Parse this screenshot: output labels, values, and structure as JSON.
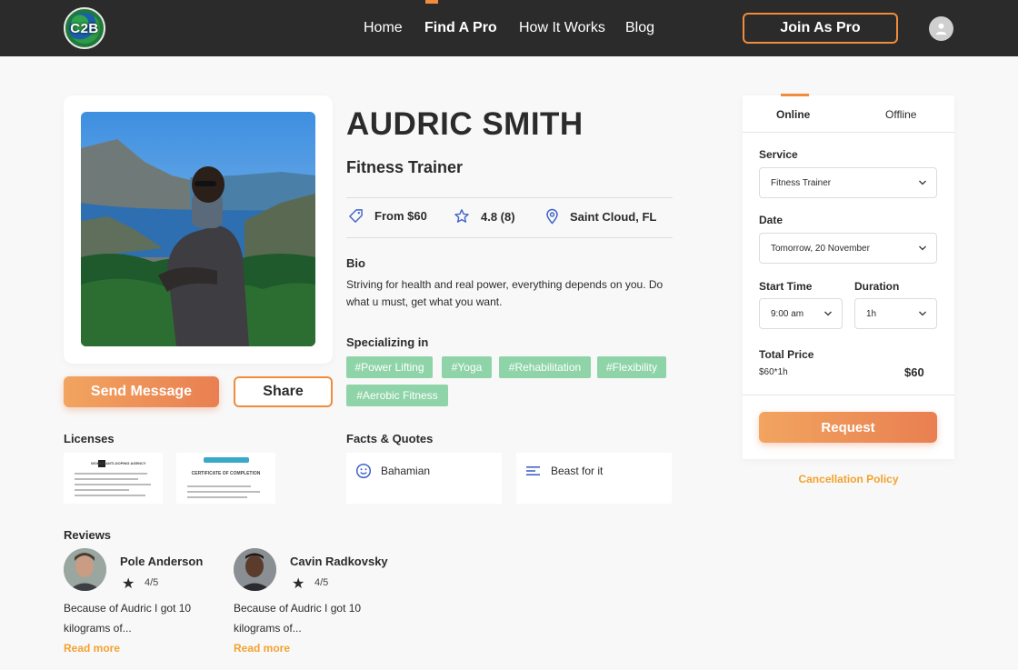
{
  "header": {
    "logo_text": "C2B",
    "nav": [
      "Home",
      "Find A Pro",
      "How It Works",
      "Blog"
    ],
    "join_label": "Join As Pro"
  },
  "profile": {
    "name": "AUDRIC SMITH",
    "title": "Fitness Trainer",
    "price": "From $60",
    "rating": "4.8 (8)",
    "location": "Saint Cloud, FL",
    "bio_label": "Bio",
    "bio": "Striving for health and real power, everything depends on you. Do what u must, get what you want.",
    "specializing_label": "Specializing in",
    "tags": [
      "#Power Lifting",
      "#Yoga",
      "#Rehabilitation",
      "#Flexibility",
      "#Aerobic Fitness"
    ],
    "facts_label": "Facts & Quotes",
    "facts": [
      {
        "icon": "smile-icon",
        "text": "Bahamian"
      },
      {
        "icon": "text-lines-icon",
        "text": "Beast for it"
      }
    ]
  },
  "actions": {
    "send_message": "Send Message",
    "share": "Share"
  },
  "licenses": {
    "label": "Licenses",
    "items": [
      {
        "title": "WORLD ANTI-DOPING AGENCY"
      },
      {
        "title": "CERTIFICATE OF COMPLETION"
      }
    ]
  },
  "reviews": {
    "label": "Reviews",
    "items": [
      {
        "name": "Pole Anderson",
        "rating": "4/5",
        "text": "Because of Audric I got 10 kilograms of...",
        "more": "Read more"
      },
      {
        "name": "Cavin Radkovsky",
        "rating": "4/5",
        "text": "Because of Audric I got 10 kilograms of...",
        "more": "Read more"
      }
    ]
  },
  "booking": {
    "tabs": [
      "Online",
      "Offline"
    ],
    "active_tab": "Online",
    "service_label": "Service",
    "service_value": "Fitness Trainer",
    "date_label": "Date",
    "date_value": "Tomorrow, 20 November",
    "start_label": "Start Time",
    "start_value": "9:00 am",
    "duration_label": "Duration",
    "duration_value": "1h",
    "total_label": "Total Price",
    "calc": "$60*1h",
    "total": "$60",
    "request_label": "Request",
    "cancel_label": "Cancellation Policy"
  },
  "colors": {
    "accent": "#f08c3c",
    "tag": "#8fd4a8",
    "link": "#f3a22e",
    "header_bg": "#2b2b2b"
  }
}
